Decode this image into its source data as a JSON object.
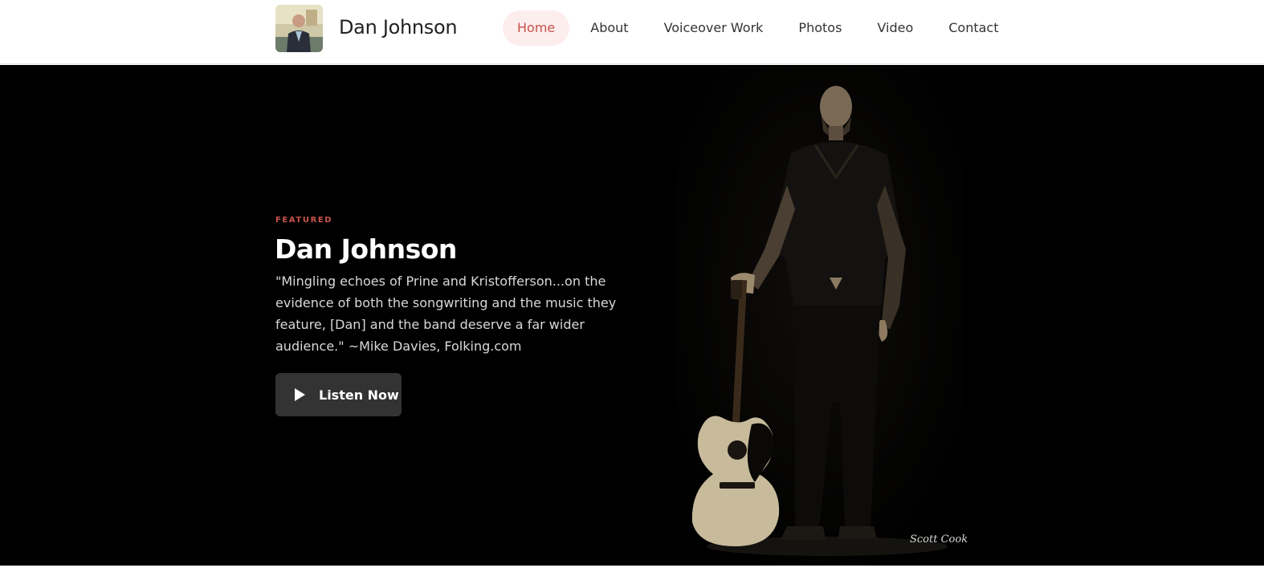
{
  "header": {
    "site_title": "Dan Johnson",
    "logo_icon": "portrait-thumbnail"
  },
  "nav": {
    "items": [
      {
        "label": "Home",
        "active": true
      },
      {
        "label": "About",
        "active": false
      },
      {
        "label": "Voiceover Work",
        "active": false
      },
      {
        "label": "Photos",
        "active": false
      },
      {
        "label": "Video",
        "active": false
      },
      {
        "label": "Contact",
        "active": false
      }
    ]
  },
  "hero": {
    "eyebrow": "FEATURED",
    "title": "Dan Johnson",
    "quote": "\"Mingling echoes of Prine and Kristofferson...on the evidence of both the songwriting and the music they feature, [Dan] and the band deserve a far wider audience.\" ~Mike Davies, Folking.com",
    "cta_label": "Listen Now",
    "cta_icon": "play-icon",
    "photo_signature": "Scott Cook"
  },
  "colors": {
    "accent": "#c8534a",
    "nav_active_bg": "#fdeeee",
    "hero_bg": "#000000",
    "button_bg": "#333333"
  }
}
